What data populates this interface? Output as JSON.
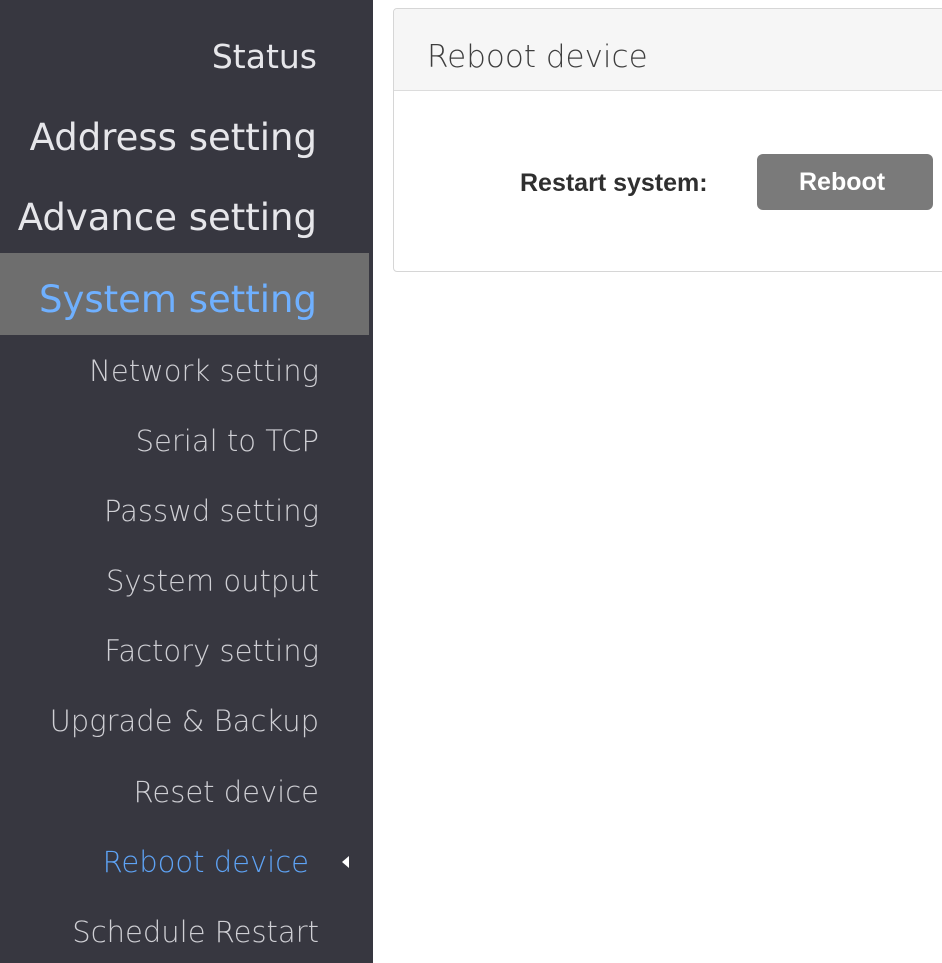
{
  "sidebar": {
    "top_items": [
      {
        "label": "Status"
      },
      {
        "label": "Address setting"
      },
      {
        "label": "Advance setting"
      },
      {
        "label": "System setting"
      }
    ],
    "sub_items": [
      {
        "label": "Network setting"
      },
      {
        "label": "Serial to TCP"
      },
      {
        "label": "Passwd setting"
      },
      {
        "label": "System output"
      },
      {
        "label": "Factory setting"
      },
      {
        "label": "Upgrade & Backup"
      },
      {
        "label": "Reset device"
      },
      {
        "label": "Reboot device"
      },
      {
        "label": "Schedule Restart"
      }
    ]
  },
  "panel": {
    "title": "Reboot device",
    "restart_label": "Restart system:",
    "reboot_button": "Reboot"
  },
  "colors": {
    "sidebar_bg": "#373740",
    "active_bg": "#6e6e6e",
    "accent": "#5ea3f5",
    "button_bg": "#7a7a7a"
  }
}
